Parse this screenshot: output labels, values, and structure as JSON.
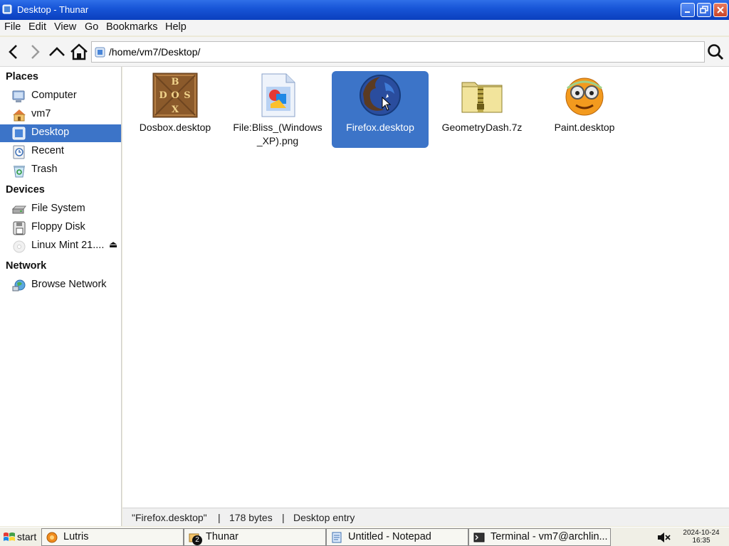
{
  "window": {
    "title": "Desktop - Thunar",
    "accent": "#0a3fbe",
    "selection_color": "#3c74c8"
  },
  "menu": [
    "File",
    "Edit",
    "View",
    "Go",
    "Bookmarks",
    "Help"
  ],
  "toolbar": {
    "icons": [
      "back-arrow-icon",
      "forward-arrow-icon",
      "up-arrow-icon",
      "home-icon",
      "search-icon"
    ],
    "path": "/home/vm7/Desktop/"
  },
  "sidebar": {
    "places": {
      "heading": "Places",
      "items": [
        {
          "label": "Computer",
          "icon": "computer-icon"
        },
        {
          "label": "vm7",
          "icon": "home-folder-icon"
        },
        {
          "label": "Desktop",
          "icon": "desktop-icon",
          "active": true
        },
        {
          "label": "Recent",
          "icon": "recent-icon"
        },
        {
          "label": "Trash",
          "icon": "trash-icon"
        }
      ]
    },
    "devices": {
      "heading": "Devices",
      "items": [
        {
          "label": "File System",
          "icon": "drive-icon"
        },
        {
          "label": "Floppy Disk",
          "icon": "floppy-icon"
        },
        {
          "label": "Linux Mint 21....",
          "icon": "disc-icon",
          "eject": "⏏"
        }
      ]
    },
    "network": {
      "heading": "Network",
      "items": [
        {
          "label": "Browse Network",
          "icon": "network-icon"
        }
      ]
    }
  },
  "files": [
    {
      "name": "Dosbox.desktop",
      "icon": "dosbox-icon"
    },
    {
      "name": "File:Bliss_(Windows _XP).png",
      "line1": "File:Bliss_(Windows",
      "line2": "_XP).png",
      "icon": "image-file-icon"
    },
    {
      "name": "Firefox.desktop",
      "icon": "firefox-icon",
      "selected": true
    },
    {
      "name": "GeometryDash.7z",
      "icon": "archive-icon"
    },
    {
      "name": "Paint.desktop",
      "icon": "paint-icon"
    }
  ],
  "status": {
    "name": "\"Firefox.desktop\"",
    "sep": "|",
    "size": "178 bytes",
    "type": "Desktop entry"
  },
  "taskbar": {
    "start": "start",
    "tasks": [
      {
        "label": "Lutris",
        "icon": "lutris-icon"
      },
      {
        "label": "Thunar",
        "icon": "thunar-icon",
        "badge": "2"
      },
      {
        "label": "Untitled - Notepad",
        "icon": "notepad-icon"
      },
      {
        "label": "Terminal - vm7@archlin...",
        "icon": "terminal-icon"
      }
    ],
    "clock_date": "2024-10-24",
    "clock_time": "16:35"
  }
}
